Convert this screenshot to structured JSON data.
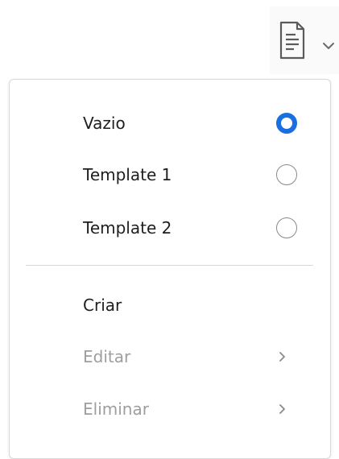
{
  "toolbar": {
    "template_button_icon": "document-icon",
    "dropdown_icon": "chevron-down-icon"
  },
  "menu": {
    "templates": [
      {
        "label": "Vazio",
        "checked": true
      },
      {
        "label": "Template 1",
        "checked": false
      },
      {
        "label": "Template 2",
        "checked": false
      }
    ],
    "actions": [
      {
        "label": "Criar",
        "enabled": true
      },
      {
        "label": "Editar",
        "enabled": false,
        "submenu_icon": "chevron-right-icon"
      },
      {
        "label": "Eliminar",
        "enabled": false,
        "submenu_icon": "chevron-right-icon"
      }
    ]
  },
  "colors": {
    "accent": "#1a6fe0",
    "text": "#1e1e1e",
    "disabled_text": "#9e9e9e",
    "border": "#d9d9d9"
  }
}
